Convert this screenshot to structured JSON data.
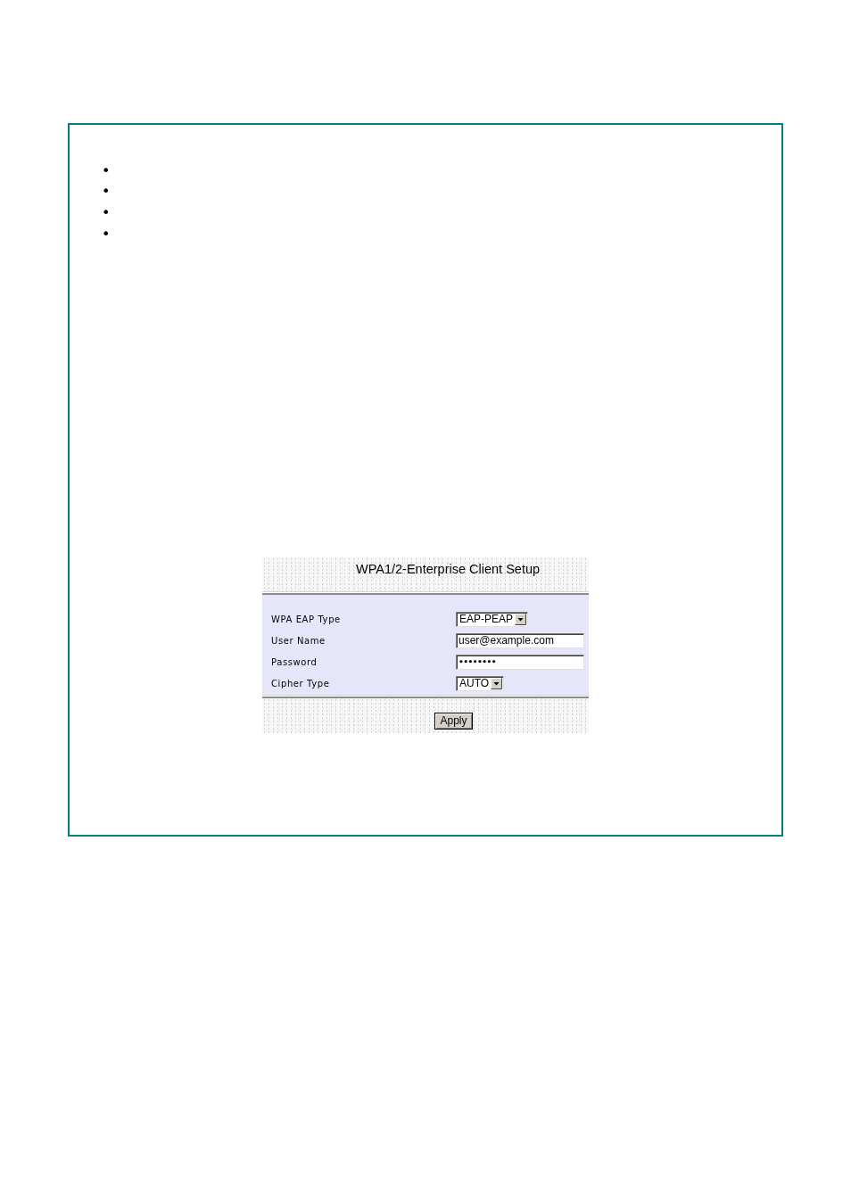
{
  "bullets": [
    "•",
    "•",
    "•",
    "•"
  ],
  "setup_panel": {
    "title": "WPA1/2-Enterprise Client Setup",
    "fields": [
      {
        "kind": "select",
        "label": "WPA EAP Type",
        "value": "EAP-PEAP"
      },
      {
        "kind": "text",
        "label": "User Name",
        "value": "user@example.com"
      },
      {
        "kind": "password",
        "label": "Password",
        "value": "••••••••"
      },
      {
        "kind": "select",
        "label": "Cipher Type",
        "value": "AUTO"
      }
    ],
    "button": "Apply"
  }
}
